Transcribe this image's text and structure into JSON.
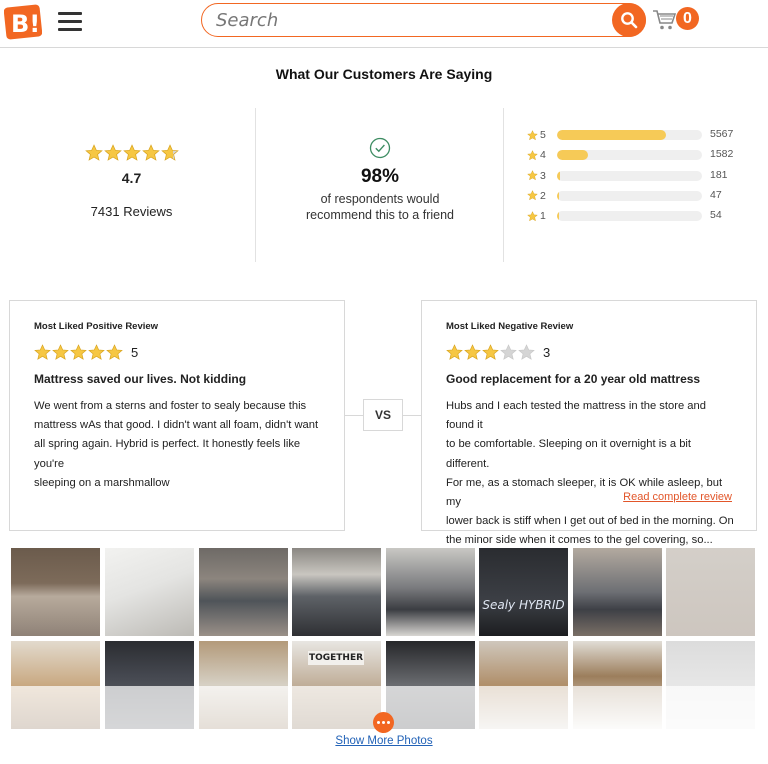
{
  "header": {
    "logo_text": "B!",
    "search_placeholder": "Search",
    "cart_count": "0"
  },
  "section_title": "What Our Customers Are Saying",
  "summary": {
    "average_rating": "4.7",
    "average_rating_value": 4.7,
    "review_count": "7431 Reviews",
    "recommend_percent": "98%",
    "recommend_text_1": "of respondents would",
    "recommend_text_2": "recommend this to a friend"
  },
  "distribution": [
    {
      "stars": "5",
      "count": "5567",
      "fraction": 0.749
    },
    {
      "stars": "4",
      "count": "1582",
      "fraction": 0.213
    },
    {
      "stars": "3",
      "count": "181",
      "fraction": 0.024
    },
    {
      "stars": "2",
      "count": "47",
      "fraction": 0.006
    },
    {
      "stars": "1",
      "count": "54",
      "fraction": 0.007
    }
  ],
  "positive_review": {
    "kicker": "Most Liked Positive Review",
    "rating": "5",
    "rating_value": 5,
    "title": "Mattress saved our lives. Not kidding",
    "lines": [
      "We went from a sterns and foster to sealy because this",
      "mattress wAs that good. I didn't want all foam, didn't want",
      "all spring again. Hybrid is perfect. It honestly feels like you're",
      "sleeping on a marshmallow"
    ]
  },
  "negative_review": {
    "kicker": "Most Liked Negative Review",
    "rating": "3",
    "rating_value": 3,
    "title": "Good replacement for a 20 year old mattress",
    "lines": [
      "Hubs and I each tested the mattress in the store and found it",
      "to be comfortable. Sleeping on it overnight is a bit different.",
      "For me, as a stomach sleeper, it is OK while asleep, but my",
      "lower back is stiff when I get out of bed in the morning. On",
      "the minor side when it comes to the gel covering, so..."
    ],
    "read_more": "Read complete review"
  },
  "vs_label": "VS",
  "photos": {
    "row1_texts": [
      "",
      "",
      "",
      "",
      "",
      "Sealy HYBRID",
      "",
      ""
    ],
    "row2_texts": [
      "",
      "",
      "",
      "TOGETHER",
      "",
      "",
      "",
      ""
    ],
    "show_more": "Show More Photos"
  },
  "colors": {
    "brand": "#f26722",
    "star": "#f6ca57",
    "link": "#2262b7"
  },
  "icons": [
    "logo-icon",
    "menu-icon",
    "search-icon",
    "cart-icon",
    "check-circle-icon",
    "star-icon",
    "more-icon"
  ]
}
